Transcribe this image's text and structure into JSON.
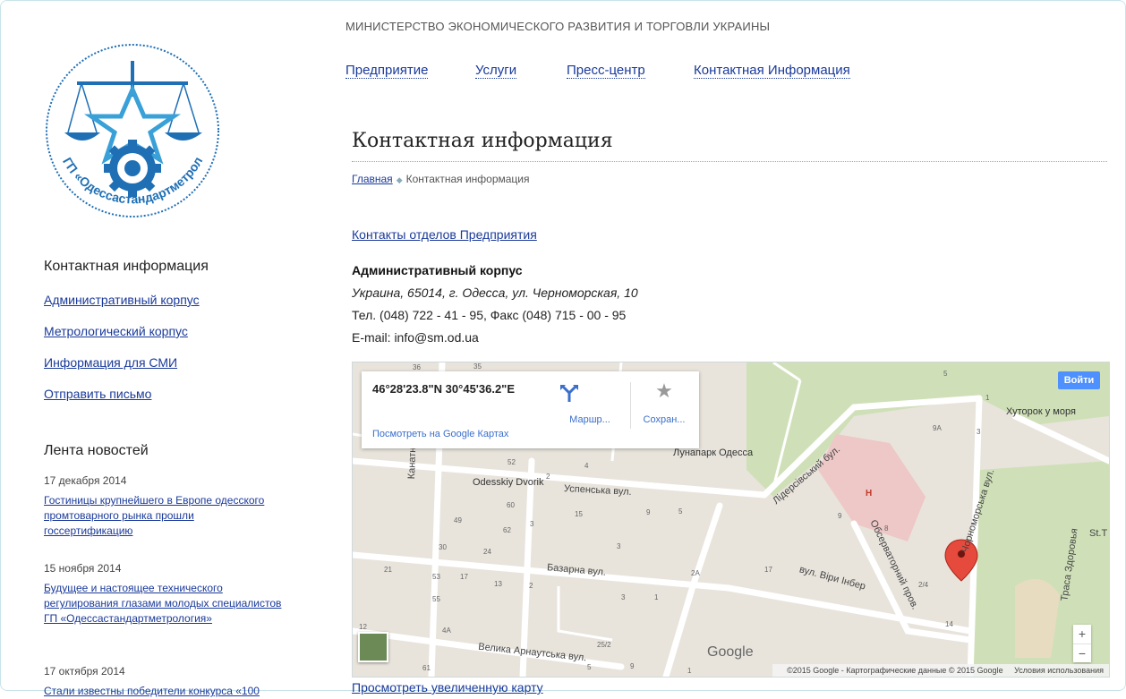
{
  "header": {
    "ministry": "МИНИСТЕРСТВО ЭКОНОМИЧЕСКОГО РАЗВИТИЯ И ТОРГОВЛИ УКРАИНЫ",
    "nav": [
      "Предприятие",
      "Услуги",
      "Пресс-центр",
      "Контактная Информация"
    ]
  },
  "logo": {
    "text": "ГП «Одессастандартметрология»",
    "color": "#1f6fb5"
  },
  "sidebar": {
    "contacts_heading": "Контактная информация",
    "contact_links": [
      "Административный корпус",
      "Метрологический корпус",
      "Информация для СМИ",
      "Отправить письмо"
    ],
    "news_heading": "Лента новостей",
    "news": [
      {
        "date": "17 декабря 2014",
        "title": "Гостиницы крупнейшего в Европе одесского промтоварного рынка прошли госсертификацию"
      },
      {
        "date": "15 ноября 2014",
        "title": "Будущее и настоящее технического регулирования глазами молодых специалистов ГП «Одессастандартметрология»"
      },
      {
        "date": "17 октября 2014",
        "title": "Стали известны победители конкурса «100"
      }
    ]
  },
  "main": {
    "title": "Контактная информация",
    "breadcrumb": {
      "home": "Главная",
      "current": "Контактная информация"
    },
    "departments_link": "Контакты отделов Предприятия",
    "block_heading": "Административный корпус",
    "address": "Украина, 65014, г. Одесса, ул. Черноморская, 10",
    "phones": "Тел. (048) 722 - 41 - 95, Факс (048) 715 - 00 - 95",
    "email": "E-mail: info@sm.od.ua",
    "larger_map_link": "Просмотреть увеличенную карту"
  },
  "map": {
    "coords": "46°28'23.8\"N 30°45'36.2\"E",
    "route_label": "Маршр...",
    "save_label": "Сохран...",
    "view_link": "Посмотреть на Google Картах",
    "signin": "Войти",
    "zoom_in": "+",
    "zoom_out": "−",
    "google": "Google",
    "copyright": "©2015 Google - Картографические данные © 2015 Google",
    "terms": "Условия использования",
    "pois": {
      "lunapark": "Лунапарк Одесса",
      "dvorik": "Odesskiy Dvorik",
      "hutorok": "Хуторок у моря"
    },
    "streets": {
      "uspenska": "Успенська вул.",
      "bazarna": "Базарна вул.",
      "arnautska": "Велика Арнаутська вул.",
      "kanatna": "Канатна вул.",
      "lidersky": "Лідерсівський бул.",
      "viri": "вул. Віри Інбер",
      "observ": "Обсерваторний пров.",
      "chornomorska": "Чорноморська вул.",
      "traса": "Траса Здоровья",
      "st": "St.T"
    },
    "house_numbers": [
      "36",
      "35",
      "5",
      "1",
      "9A",
      "3",
      "52",
      "4",
      "2",
      "Н",
      "60",
      "3",
      "15",
      "9",
      "5",
      "9",
      "49",
      "62",
      "3",
      "8",
      "30",
      "24",
      "2A",
      "17",
      "21",
      "53",
      "17",
      "13",
      "2",
      "3",
      "1",
      "2/4",
      "55",
      "14",
      "4A",
      "12",
      "25/2",
      "61",
      "5",
      "9",
      "1"
    ]
  }
}
